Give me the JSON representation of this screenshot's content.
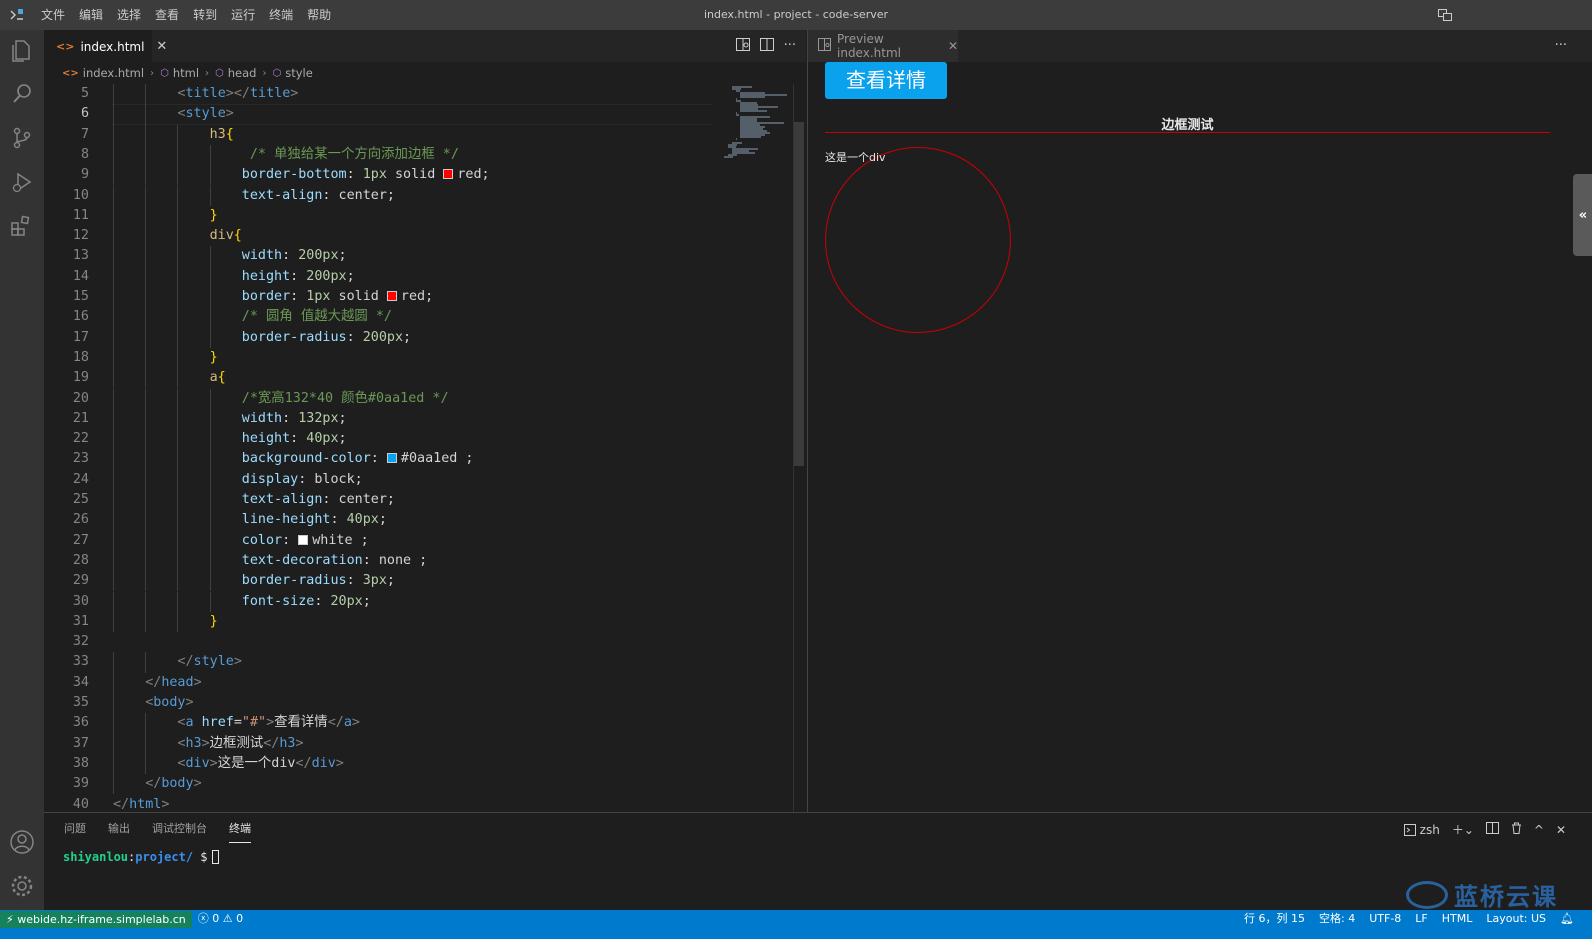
{
  "window": {
    "title": "index.html - project - code-server",
    "menu": [
      "文件",
      "编辑",
      "选择",
      "查看",
      "转到",
      "运行",
      "终端",
      "帮助"
    ]
  },
  "activity_bar": [
    "explorer-icon",
    "search-icon",
    "source-control-icon",
    "run-debug-icon",
    "extensions-icon",
    "account-icon",
    "manage-gear-icon"
  ],
  "editor": {
    "tab": {
      "icon": "<>",
      "label": "index.html",
      "close": "✕"
    },
    "breadcrumbs": [
      "index.html",
      "html",
      "head",
      "style"
    ],
    "current_line": 6,
    "lines": [
      {
        "n": "5",
        "indent": 2,
        "tokens": [
          [
            "tg",
            "<"
          ],
          [
            "tn",
            "title"
          ],
          [
            "tg",
            "></"
          ],
          [
            "tn",
            "title"
          ],
          [
            "tg",
            ">"
          ]
        ]
      },
      {
        "n": "6",
        "indent": 2,
        "tokens": [
          [
            "tg",
            "<"
          ],
          [
            "tn",
            "style"
          ],
          [
            "tg",
            ">"
          ]
        ]
      },
      {
        "n": "7",
        "indent": 3,
        "tokens": [
          [
            "sel",
            "h3"
          ],
          [
            "br",
            "{"
          ]
        ]
      },
      {
        "n": "8",
        "indent": 4,
        "tokens": [
          [
            "cm",
            " /* 单独给某一个方向添加边框 */"
          ]
        ]
      },
      {
        "n": "9",
        "indent": 4,
        "tokens": [
          [
            "pr",
            "border-bottom"
          ],
          [
            "vl",
            ": "
          ],
          [
            "nu",
            "1px"
          ],
          [
            "vl",
            " solid "
          ],
          [
            "swatch",
            "#ff0000"
          ],
          [
            "vl",
            "red;"
          ]
        ]
      },
      {
        "n": "10",
        "indent": 4,
        "tokens": [
          [
            "pr",
            "text-align"
          ],
          [
            "vl",
            ": center;"
          ]
        ]
      },
      {
        "n": "11",
        "indent": 3,
        "tokens": [
          [
            "br",
            "}"
          ]
        ]
      },
      {
        "n": "12",
        "indent": 3,
        "tokens": [
          [
            "sel",
            "div"
          ],
          [
            "br",
            "{"
          ]
        ]
      },
      {
        "n": "13",
        "indent": 4,
        "tokens": [
          [
            "pr",
            "width"
          ],
          [
            "vl",
            ": "
          ],
          [
            "nu",
            "200px"
          ],
          [
            "vl",
            ";"
          ]
        ]
      },
      {
        "n": "14",
        "indent": 4,
        "tokens": [
          [
            "pr",
            "height"
          ],
          [
            "vl",
            ": "
          ],
          [
            "nu",
            "200px"
          ],
          [
            "vl",
            ";"
          ]
        ]
      },
      {
        "n": "15",
        "indent": 4,
        "tokens": [
          [
            "pr",
            "border"
          ],
          [
            "vl",
            ": "
          ],
          [
            "nu",
            "1px"
          ],
          [
            "vl",
            " solid "
          ],
          [
            "swatch",
            "#ff0000"
          ],
          [
            "vl",
            "red;"
          ]
        ]
      },
      {
        "n": "16",
        "indent": 4,
        "tokens": [
          [
            "cm",
            "/* 圆角 值越大越圆 */"
          ]
        ]
      },
      {
        "n": "17",
        "indent": 4,
        "tokens": [
          [
            "pr",
            "border-radius"
          ],
          [
            "vl",
            ": "
          ],
          [
            "nu",
            "200px"
          ],
          [
            "vl",
            ";"
          ]
        ]
      },
      {
        "n": "18",
        "indent": 3,
        "tokens": [
          [
            "br",
            "}"
          ]
        ]
      },
      {
        "n": "19",
        "indent": 3,
        "tokens": [
          [
            "sel",
            "a"
          ],
          [
            "br",
            "{"
          ]
        ]
      },
      {
        "n": "20",
        "indent": 4,
        "tokens": [
          [
            "cm",
            "/*宽高132*40 颜色#0aa1ed */"
          ]
        ]
      },
      {
        "n": "21",
        "indent": 4,
        "tokens": [
          [
            "pr",
            "width"
          ],
          [
            "vl",
            ": "
          ],
          [
            "nu",
            "132px"
          ],
          [
            "vl",
            ";"
          ]
        ]
      },
      {
        "n": "22",
        "indent": 4,
        "tokens": [
          [
            "pr",
            "height"
          ],
          [
            "vl",
            ": "
          ],
          [
            "nu",
            "40px"
          ],
          [
            "vl",
            ";"
          ]
        ]
      },
      {
        "n": "23",
        "indent": 4,
        "tokens": [
          [
            "pr",
            "background-color"
          ],
          [
            "vl",
            ": "
          ],
          [
            "swatch",
            "#0aa1ed"
          ],
          [
            "vl",
            "#0aa1ed ;"
          ]
        ]
      },
      {
        "n": "24",
        "indent": 4,
        "tokens": [
          [
            "pr",
            "display"
          ],
          [
            "vl",
            ": block;"
          ]
        ]
      },
      {
        "n": "25",
        "indent": 4,
        "tokens": [
          [
            "pr",
            "text-align"
          ],
          [
            "vl",
            ": center;"
          ]
        ]
      },
      {
        "n": "26",
        "indent": 4,
        "tokens": [
          [
            "pr",
            "line-height"
          ],
          [
            "vl",
            ": "
          ],
          [
            "nu",
            "40px"
          ],
          [
            "vl",
            ";"
          ]
        ]
      },
      {
        "n": "27",
        "indent": 4,
        "tokens": [
          [
            "pr",
            "color"
          ],
          [
            "vl",
            ": "
          ],
          [
            "swatch",
            "#ffffff"
          ],
          [
            "vl",
            "white ;"
          ]
        ]
      },
      {
        "n": "28",
        "indent": 4,
        "tokens": [
          [
            "pr",
            "text-decoration"
          ],
          [
            "vl",
            ": none ;"
          ]
        ]
      },
      {
        "n": "29",
        "indent": 4,
        "tokens": [
          [
            "pr",
            "border-radius"
          ],
          [
            "vl",
            ": "
          ],
          [
            "nu",
            "3px"
          ],
          [
            "vl",
            ";"
          ]
        ]
      },
      {
        "n": "30",
        "indent": 4,
        "tokens": [
          [
            "pr",
            "font-size"
          ],
          [
            "vl",
            ": "
          ],
          [
            "nu",
            "20px"
          ],
          [
            "vl",
            ";"
          ]
        ]
      },
      {
        "n": "31",
        "indent": 3,
        "tokens": [
          [
            "br",
            "}"
          ]
        ]
      },
      {
        "n": "32",
        "indent": 0,
        "tokens": []
      },
      {
        "n": "33",
        "indent": 2,
        "tokens": [
          [
            "tg",
            "</"
          ],
          [
            "tn",
            "style"
          ],
          [
            "tg",
            ">"
          ]
        ]
      },
      {
        "n": "34",
        "indent": 1,
        "tokens": [
          [
            "tg",
            "</"
          ],
          [
            "tn",
            "head"
          ],
          [
            "tg",
            ">"
          ]
        ]
      },
      {
        "n": "35",
        "indent": 1,
        "tokens": [
          [
            "tg",
            "<"
          ],
          [
            "tn",
            "body"
          ],
          [
            "tg",
            ">"
          ]
        ]
      },
      {
        "n": "36",
        "indent": 2,
        "tokens": [
          [
            "tg",
            "<"
          ],
          [
            "tn",
            "a"
          ],
          [
            "vl",
            " "
          ],
          [
            "an",
            "href"
          ],
          [
            "vl",
            "="
          ],
          [
            "av",
            "\"#\""
          ],
          [
            "tg",
            ">"
          ],
          [
            "vl",
            "查看详情"
          ],
          [
            "tg",
            "</"
          ],
          [
            "tn",
            "a"
          ],
          [
            "tg",
            ">"
          ]
        ]
      },
      {
        "n": "37",
        "indent": 2,
        "tokens": [
          [
            "tg",
            "<"
          ],
          [
            "tn",
            "h3"
          ],
          [
            "tg",
            ">"
          ],
          [
            "vl",
            "边框测试"
          ],
          [
            "tg",
            "</"
          ],
          [
            "tn",
            "h3"
          ],
          [
            "tg",
            ">"
          ]
        ]
      },
      {
        "n": "38",
        "indent": 2,
        "tokens": [
          [
            "tg",
            "<"
          ],
          [
            "tn",
            "div"
          ],
          [
            "tg",
            ">"
          ],
          [
            "vl",
            "这是一个div"
          ],
          [
            "tg",
            "</"
          ],
          [
            "tn",
            "div"
          ],
          [
            "tg",
            ">"
          ]
        ]
      },
      {
        "n": "39",
        "indent": 1,
        "tokens": [
          [
            "tg",
            "</"
          ],
          [
            "tn",
            "body"
          ],
          [
            "tg",
            ">"
          ]
        ]
      },
      {
        "n": "40",
        "indent": 0,
        "tokens": [
          [
            "tg",
            "</"
          ],
          [
            "tn",
            "html"
          ],
          [
            "tg",
            ">"
          ]
        ]
      }
    ]
  },
  "preview": {
    "tab_label": "Preview index.html",
    "tab_close": "✕",
    "more": "···",
    "link_text": "查看详情",
    "heading": "边框测试",
    "div_text": "这是一个div",
    "handle": "«"
  },
  "panel": {
    "tabs": [
      "问题",
      "输出",
      "调试控制台",
      "终端"
    ],
    "active_tab": "终端",
    "shell": "zsh",
    "terminal": {
      "user": "shiyanlou",
      "path": "project/",
      "prompt": " $"
    },
    "watermark": "蓝桥云课"
  },
  "statusbar": {
    "remote": "webide.hz-iframe.simplelab.cn",
    "errors": "0",
    "warnings": "0",
    "position": "行 6，列 15",
    "indent": "空格: 4",
    "encoding": "UTF-8",
    "eol": "LF",
    "language": "HTML",
    "layout": "Layout: US"
  },
  "colors": {
    "accent": "#007acc",
    "link_bg": "#0aa1ed",
    "border_red": "#cc0000"
  }
}
